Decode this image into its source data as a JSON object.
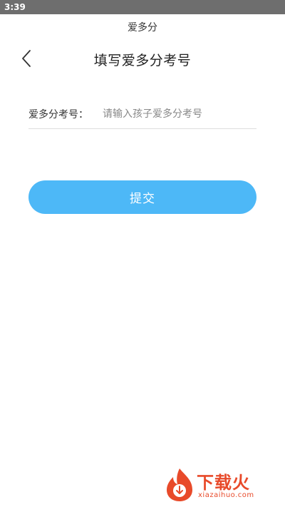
{
  "status_bar": {
    "time": "3:39"
  },
  "app": {
    "name": "爱多分"
  },
  "header": {
    "title": "填写爱多分考号",
    "back_icon": "chevron-left-icon"
  },
  "form": {
    "label": "爱多分考号：",
    "placeholder": "请输入孩子爱多分考号",
    "value": ""
  },
  "submit": {
    "label": "提交"
  },
  "watermark": {
    "brand": "下载火",
    "url": "xiazaihuo.com"
  },
  "colors": {
    "accent": "#4db8f7",
    "status_bar": "#6e6e6e",
    "watermark": "#e84a2a"
  }
}
